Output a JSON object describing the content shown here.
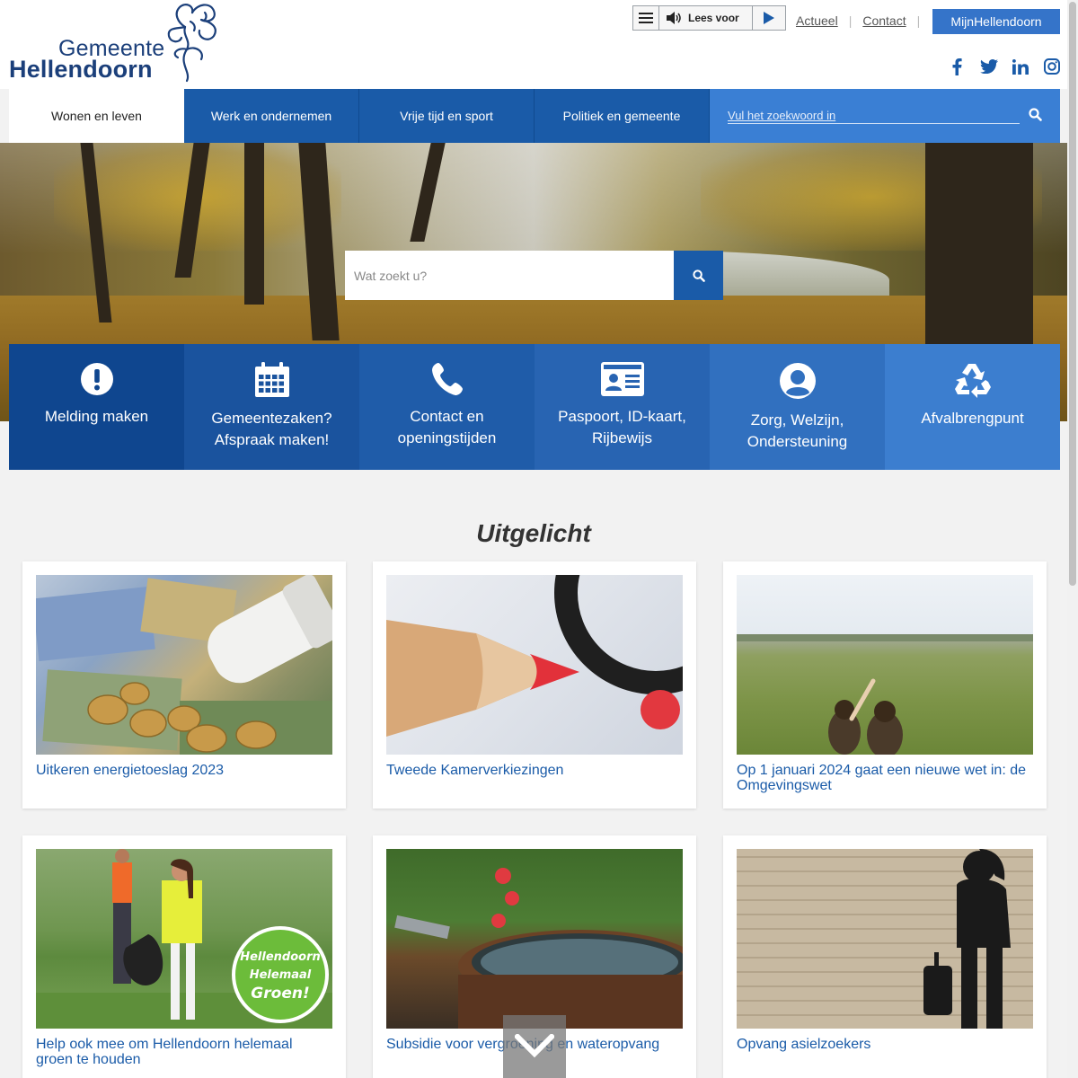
{
  "header": {
    "logo_line1": "Gemeente",
    "logo_line2": "Hellendoorn",
    "readspeaker_label": "Lees voor",
    "links": [
      "Actueel",
      "Contact"
    ],
    "account_button": "MijnHellendoorn",
    "socials": [
      "facebook-icon",
      "twitter-icon",
      "linkedin-icon",
      "instagram-icon"
    ]
  },
  "nav": {
    "items": [
      {
        "label": "Wonen en leven",
        "active": true
      },
      {
        "label": "Werk en ondernemen",
        "active": false
      },
      {
        "label": "Vrije tijd en sport",
        "active": false
      },
      {
        "label": "Politiek en gemeente",
        "active": false
      }
    ],
    "search_placeholder": "Vul het zoekwoord in"
  },
  "hero": {
    "search_placeholder": "Wat zoekt u?"
  },
  "tiles": [
    {
      "line1": "Melding maken",
      "line2": "",
      "icon": "exclamation-icon"
    },
    {
      "line1": "Gemeentezaken?",
      "line2": "Afspraak maken!",
      "icon": "calendar-icon"
    },
    {
      "line1": "Contact en",
      "line2": "openingstijden",
      "icon": "phone-icon"
    },
    {
      "line1": "Paspoort, ID-kaart,",
      "line2": "Rijbewijs",
      "icon": "id-card-icon"
    },
    {
      "line1": "Zorg, Welzijn,",
      "line2": "Ondersteuning",
      "icon": "user-icon"
    },
    {
      "line1": "Afvalbrengpunt",
      "line2": "",
      "icon": "recycle-icon"
    }
  ],
  "featured": {
    "title": "Uitgelicht",
    "cards": [
      {
        "caption": "Uitkeren energietoeslag 2023"
      },
      {
        "caption": "Tweede Kamerverkiezingen"
      },
      {
        "caption": "Op 1 januari 2024 gaat een nieuwe wet in: de Omgevingswet"
      },
      {
        "caption": "Help ook mee om Hellendoorn helemaal groen te houden"
      },
      {
        "caption": "Subsidie voor vergroening en wateropvang"
      },
      {
        "caption": "Opvang asielzoekers"
      }
    ],
    "badge_line1": "Hellendoorn",
    "badge_line2": "Helemaal",
    "badge_line3": "Groen!"
  },
  "colors": {
    "brand_blue": "#1a5ba8",
    "light_blue": "#3a7fd4",
    "logo_navy": "#1b3f7a"
  }
}
